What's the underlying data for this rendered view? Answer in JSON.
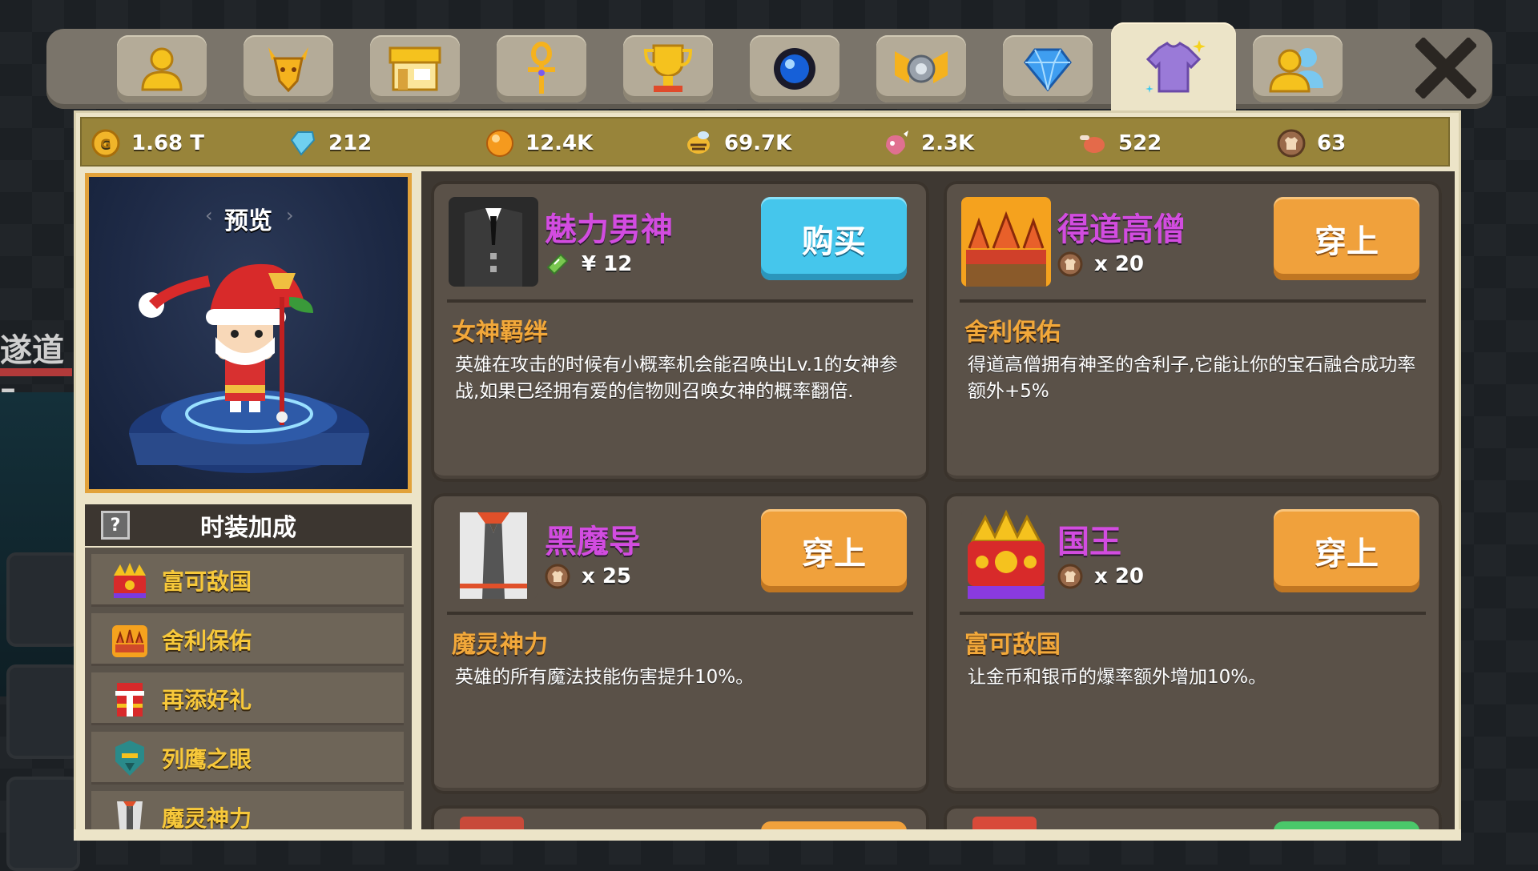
{
  "tabs": [
    {
      "icon": "profile-icon"
    },
    {
      "icon": "deer-head-icon"
    },
    {
      "icon": "shop-icon"
    },
    {
      "icon": "ankh-icon"
    },
    {
      "icon": "trophy-icon"
    },
    {
      "icon": "orb-icon"
    },
    {
      "icon": "emblem-icon"
    },
    {
      "icon": "gem-icon"
    },
    {
      "icon": "outfit-icon",
      "active": true
    },
    {
      "icon": "friends-icon"
    }
  ],
  "currencies": [
    {
      "icon": "gold-coin-icon",
      "value": "1.68 T",
      "color": "#f1b52a"
    },
    {
      "icon": "diamond-icon",
      "value": "212",
      "color": "#6fd0f0"
    },
    {
      "icon": "orange-orb-icon",
      "value": "12.4K",
      "color": "#f59a1e"
    },
    {
      "icon": "bee-token-icon",
      "value": "69.7K",
      "color": "#f0b830"
    },
    {
      "icon": "pink-token-icon",
      "value": "2.3K",
      "color": "#e07090"
    },
    {
      "icon": "meat-token-icon",
      "value": "522",
      "color": "#e46a4a"
    },
    {
      "icon": "costume-coin-icon",
      "value": "63",
      "color": "#9a6a4a"
    }
  ],
  "preview": {
    "title": "预览",
    "prev": "‹",
    "next": "›"
  },
  "bonus": {
    "title": "时装加成",
    "help": "?",
    "items": [
      {
        "label": "富可敌国",
        "icon": "king-crown-icon"
      },
      {
        "label": "舍利保佑",
        "icon": "monk-crown-icon"
      },
      {
        "label": "再添好礼",
        "icon": "santa-icon"
      },
      {
        "label": "列鹰之眼",
        "icon": "eagle-eye-icon"
      },
      {
        "label": "魔灵神力",
        "icon": "dark-mage-icon"
      }
    ]
  },
  "cards": [
    {
      "name": "魅力男神",
      "price_icon": "ticket-icon",
      "price": "¥ 12",
      "action": "购买",
      "action_type": "buy",
      "skill": "女神羁绊",
      "desc": "英雄在攻击的时候有小概率机会能召唤出Lv.1的女神参战,如果已经拥有爱的信物则召唤女神的概率翻倍.",
      "thumb": "suit-icon"
    },
    {
      "name": "得道高僧",
      "price_icon": "costume-coin-icon",
      "price": "x 20",
      "action": "穿上",
      "action_type": "wear",
      "skill": "舍利保佑",
      "desc": "得道高僧拥有神圣的舍利子,它能让你的宝石融合成功率额外+5%",
      "thumb": "monk-crown-icon"
    },
    {
      "name": "黑魔导",
      "price_icon": "costume-coin-icon",
      "price": "x 25",
      "action": "穿上",
      "action_type": "wear",
      "skill": "魔灵神力",
      "desc": "英雄的所有魔法技能伤害提升10%。",
      "thumb": "dark-mage-icon"
    },
    {
      "name": "国王",
      "price_icon": "costume-coin-icon",
      "price": "x 20",
      "action": "穿上",
      "action_type": "wear",
      "skill": "富可敌国",
      "desc": "让金币和银币的爆率额外增加10%。",
      "thumb": "king-crown-icon"
    }
  ],
  "background": {
    "left_text": "遂道 –"
  }
}
